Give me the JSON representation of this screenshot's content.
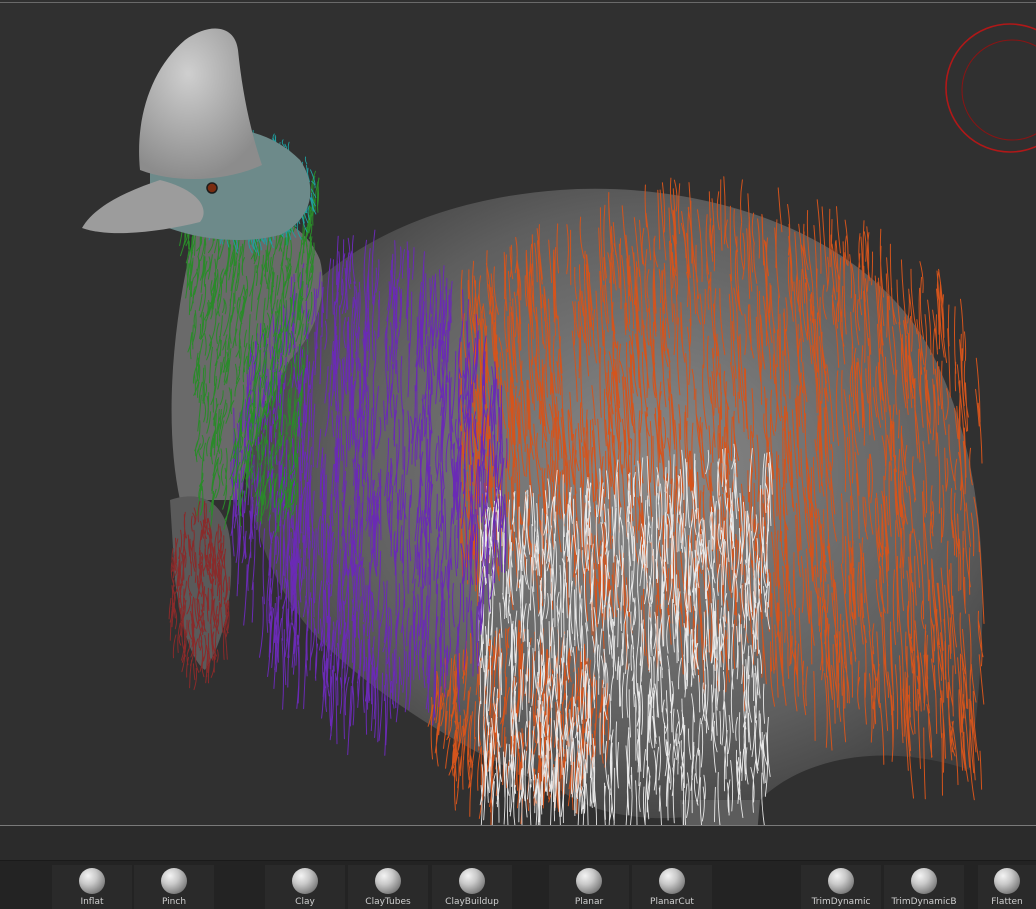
{
  "viewport": {
    "background": "#303030",
    "model_subject": "cassowary-sculpt",
    "fur_colors": {
      "head": "#1fa0a0",
      "neck": "#2a8a2a",
      "chest": "#6a2ab5",
      "back": "#d4541c",
      "belly": "#e8e8e8",
      "wattle": "#8a2a2a"
    },
    "gizmo_color": "#b01818"
  },
  "brush_shelf": {
    "items": [
      {
        "label": "Inflat",
        "icon": "inflate-brush-icon"
      },
      {
        "label": "Pinch",
        "icon": "pinch-brush-icon"
      },
      {
        "label": "Clay",
        "icon": "clay-brush-icon"
      },
      {
        "label": "ClayTubes",
        "icon": "claytubes-brush-icon"
      },
      {
        "label": "ClayBuildup",
        "icon": "claybuildup-brush-icon"
      },
      {
        "label": "Planar",
        "icon": "planar-brush-icon"
      },
      {
        "label": "PlanarCut",
        "icon": "planarcut-brush-icon"
      },
      {
        "label": "TrimDynamic",
        "icon": "trimdynamic-brush-icon"
      },
      {
        "label": "TrimDynamicB",
        "icon": "trimdynamicb-brush-icon"
      },
      {
        "label": "Flatten",
        "icon": "flatten-brush-icon"
      }
    ]
  }
}
